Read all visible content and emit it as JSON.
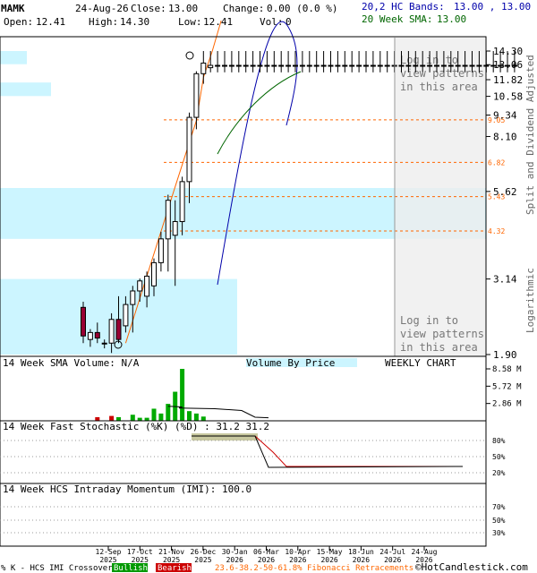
{
  "header": {
    "symbol": "MAMK",
    "date": "24-Aug-26",
    "close_label": "Close:",
    "close": "13.00",
    "change_label": "Change:",
    "change": "0.00 (0.0 %)",
    "open_label": "Open:",
    "open": "12.41",
    "high_label": "High:",
    "high": "14.30",
    "low_label": "Low:",
    "low": "12.41",
    "vol_label": "Vol:",
    "vol": "0",
    "bands_label": "20,2 HC Bands:",
    "bands_value": "13.00 , 13.00",
    "sma_label": "20 Week SMA:",
    "sma_value": "13.00"
  },
  "colors": {
    "up_candle": "#ffffff",
    "down_candle": "#990033",
    "upper_band": "#0000aa",
    "sma": "#006600",
    "fib": "#ff6600",
    "volume_up": "#00aa00",
    "volume_down": "#cc0000",
    "vbp": "#ccf5ff",
    "login_overlay": "#eeeeee"
  },
  "labels": {
    "right_axis": "Split and Dividend Adjusted",
    "log_axis": "Logarithmic",
    "login_text": "Log in to view patterns in this area",
    "volume_title": "14 Week SMA Volume: N/A",
    "vbp_title": "Volume By Price",
    "weekly": "WEEKLY CHART",
    "stoch_title": "14 Week Fast Stochastic (%K) (%D) : 31.2  31.2",
    "imi_title": "14 Week HCS Intraday Momentum (IMI): 100.0",
    "footer_prefix": "% K - HCS IMI Crossover:",
    "bullish": "Bullish",
    "bearish": "Bearish",
    "fib_text": "23.6-38.2-50-61.8% Fibonacci Retracements",
    "copyright": "©HotCandlestick.com"
  },
  "chart_data": {
    "type": "candlestick",
    "price_axis": {
      "scale": "log",
      "min": 1.9,
      "max": 14.3,
      "ticks": [
        14.3,
        13.06,
        11.82,
        10.58,
        9.34,
        8.1,
        5.62,
        3.14,
        1.9
      ]
    },
    "x_ticks": [
      "12-Sep 2025",
      "17-Oct 2025",
      "21-Nov 2025",
      "26-Dec 2025",
      "30-Jan 2026",
      "06-Mar 2026",
      "10-Apr 2026",
      "15-May 2026",
      "18-Jun 2026",
      "24-Jul 2026",
      "24-Aug 2026"
    ],
    "candles": [
      {
        "o": 2.6,
        "h": 2.7,
        "l": 2.05,
        "c": 2.15
      },
      {
        "o": 2.1,
        "h": 2.25,
        "l": 2.0,
        "c": 2.2
      },
      {
        "o": 2.2,
        "h": 2.35,
        "l": 2.05,
        "c": 2.12
      },
      {
        "o": 2.05,
        "h": 2.1,
        "l": 1.98,
        "c": 2.05
      },
      {
        "o": 2.05,
        "h": 2.5,
        "l": 1.92,
        "c": 2.4
      },
      {
        "o": 2.4,
        "h": 2.8,
        "l": 2.05,
        "c": 2.1
      },
      {
        "o": 2.3,
        "h": 2.8,
        "l": 2.2,
        "c": 2.65
      },
      {
        "o": 2.65,
        "h": 3.0,
        "l": 2.2,
        "c": 2.9
      },
      {
        "o": 2.9,
        "h": 3.15,
        "l": 2.7,
        "c": 3.1
      },
      {
        "o": 2.8,
        "h": 3.3,
        "l": 2.6,
        "c": 3.2
      },
      {
        "o": 3.0,
        "h": 3.6,
        "l": 2.8,
        "c": 3.5
      },
      {
        "o": 3.5,
        "h": 4.3,
        "l": 3.3,
        "c": 4.1
      },
      {
        "o": 4.1,
        "h": 5.5,
        "l": 3.3,
        "c": 5.3
      },
      {
        "o": 4.2,
        "h": 5.3,
        "l": 3.0,
        "c": 4.6
      },
      {
        "o": 4.6,
        "h": 6.2,
        "l": 4.2,
        "c": 6.0
      },
      {
        "o": 6.0,
        "h": 9.5,
        "l": 5.2,
        "c": 9.2
      },
      {
        "o": 9.2,
        "h": 12.5,
        "l": 8.5,
        "c": 12.3
      },
      {
        "o": 12.3,
        "h": 14.3,
        "l": 11.5,
        "c": 13.2
      },
      {
        "o": 12.8,
        "h": 14.3,
        "l": 12.41,
        "c": 13.0
      }
    ],
    "flat_close": 13.0,
    "flat_high": 14.3,
    "flat_low": 12.41,
    "flat_weeks": 43,
    "fib_levels": [
      {
        "label": "9.05",
        "value": 9.05
      },
      {
        "label": "6.82",
        "value": 6.82
      },
      {
        "label": "5.43",
        "value": 5.43
      },
      {
        "label": "4.32",
        "value": 4.32
      }
    ],
    "upper_band": [
      [
        3.14,
        0
      ],
      [
        4.5,
        3
      ],
      [
        7,
        6
      ],
      [
        10.5,
        9
      ],
      [
        13.0,
        12
      ],
      [
        14.0,
        14
      ],
      [
        15.0,
        17
      ],
      [
        13.5,
        19
      ],
      [
        12.3,
        21
      ],
      [
        11.9,
        23
      ]
    ],
    "sma_line": [
      [
        7.5,
        0
      ],
      [
        9.2,
        4
      ],
      [
        10.8,
        8
      ],
      [
        11.9,
        12
      ],
      [
        12.5,
        15
      ],
      [
        12.9,
        18
      ]
    ],
    "volume": {
      "max": 8.58,
      "ticks": [
        8.58,
        5.72,
        2.86
      ],
      "bars": [
        0,
        0,
        0.6,
        0,
        0.8,
        0.6,
        0,
        1.0,
        0.5,
        0.5,
        2.0,
        1.2,
        2.8,
        4.8,
        8.58,
        1.6,
        1.2,
        0.7
      ],
      "bar_colors": [
        "up",
        "up",
        "down",
        "up",
        "down",
        "up",
        "up",
        "up",
        "up",
        "up",
        "up",
        "up",
        "up",
        "up",
        "up",
        "up",
        "up",
        "up"
      ],
      "sma": [
        [
          2.8,
          0
        ],
        [
          2.6,
          2
        ],
        [
          2.4,
          5
        ],
        [
          2.0,
          9
        ],
        [
          1.4,
          11
        ]
      ]
    },
    "stochastic": {
      "ticks": [
        80,
        50,
        20
      ],
      "k": [
        [
          91,
          0
        ],
        [
          91,
          4
        ],
        [
          91,
          8
        ],
        [
          91,
          12
        ],
        [
          85,
          16
        ],
        [
          31.2,
          19
        ],
        [
          31.2,
          23
        ],
        [
          31.2,
          60
        ]
      ],
      "d": [
        [
          91,
          8
        ],
        [
          87,
          14
        ],
        [
          60,
          17
        ],
        [
          31.2,
          21
        ],
        [
          31.2,
          60
        ]
      ]
    },
    "imi": {
      "ticks": [
        70,
        50,
        30
      ]
    }
  }
}
